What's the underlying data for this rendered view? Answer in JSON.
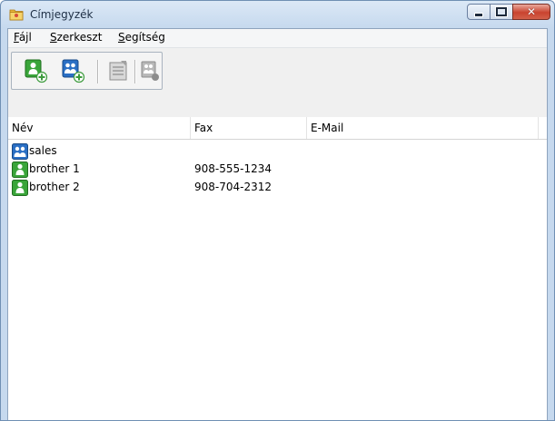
{
  "window": {
    "title": "Címjegyzék",
    "title_icon": "address-book-icon"
  },
  "menu": {
    "items": [
      {
        "label_ul": "F",
        "label_rest": "ájl"
      },
      {
        "label_ul": "S",
        "label_rest": "zerkeszt"
      },
      {
        "label_ul": "S",
        "label_rest": "egítség"
      }
    ]
  },
  "toolbar": {
    "buttons": [
      "new-member-icon",
      "new-group-icon",
      "edit-icon",
      "send-fax-icon"
    ]
  },
  "columns": [
    "Név",
    "Fax",
    "E-Mail"
  ],
  "rows": [
    {
      "type": "group",
      "name": "sales",
      "fax": "",
      "email": ""
    },
    {
      "type": "member",
      "name": "brother 1",
      "fax": "908-555-1234",
      "email": ""
    },
    {
      "type": "member",
      "name": "brother 2",
      "fax": "908-704-2312",
      "email": ""
    }
  ],
  "colors": {
    "group_icon": "#2a6fc4",
    "member_icon": "#3aa53a",
    "add_badge": "#3d9b3d"
  }
}
